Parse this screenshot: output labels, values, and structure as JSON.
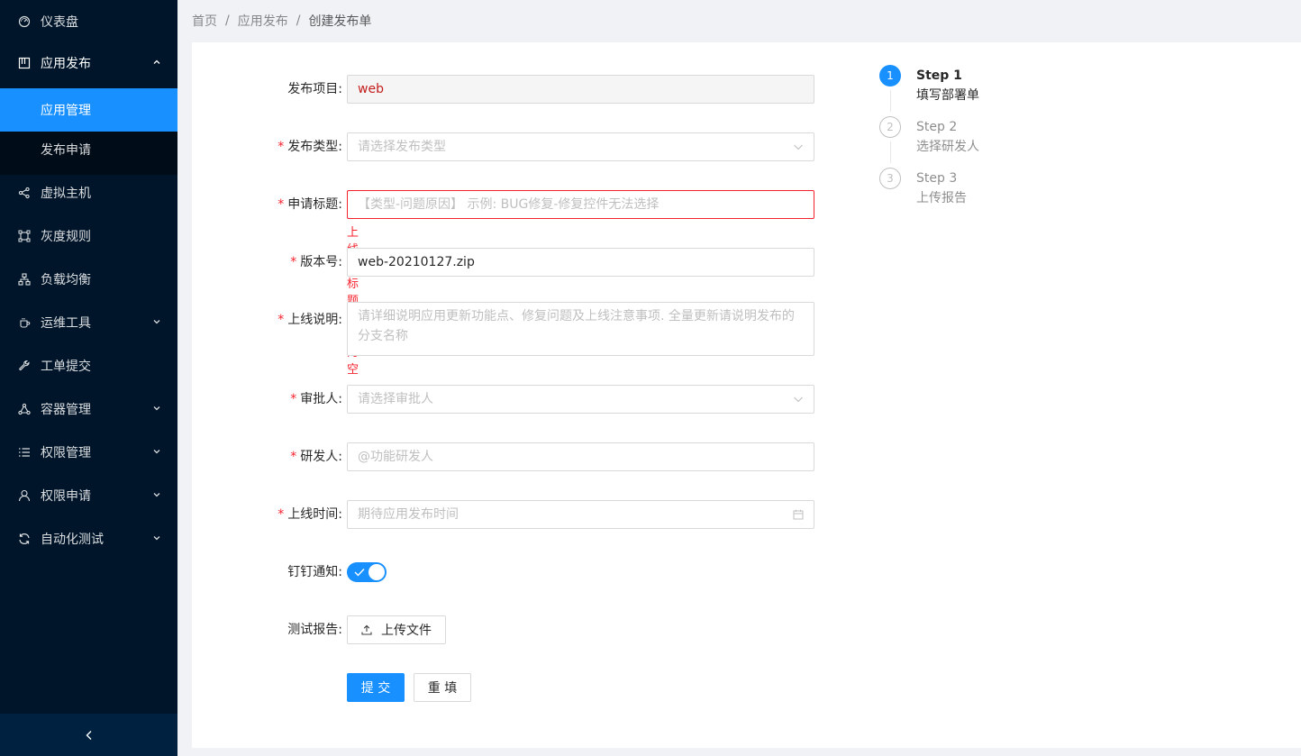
{
  "sidebar": {
    "items": [
      {
        "label": "仪表盘",
        "icon": "dashboard-icon"
      },
      {
        "label": "应用发布",
        "icon": "layout-icon",
        "expanded": true
      },
      {
        "label": "应用管理",
        "active": true
      },
      {
        "label": "发布申请"
      },
      {
        "label": "虚拟主机",
        "icon": "share-icon"
      },
      {
        "label": "灰度规则",
        "icon": "gateway-icon"
      },
      {
        "label": "负载均衡",
        "icon": "cluster-icon"
      },
      {
        "label": "运维工具",
        "icon": "tool-icon",
        "has_children": true
      },
      {
        "label": "工单提交",
        "icon": "wrench-icon"
      },
      {
        "label": "容器管理",
        "icon": "deployment-icon",
        "has_children": true
      },
      {
        "label": "权限管理",
        "icon": "list-icon",
        "has_children": true
      },
      {
        "label": "权限申请",
        "icon": "user-icon",
        "has_children": true
      },
      {
        "label": "自动化测试",
        "icon": "sync-icon",
        "has_children": true
      }
    ],
    "collapse_icon": "chevron-left-icon"
  },
  "breadcrumb": {
    "items": [
      "首页",
      "应用发布",
      "创建发布单"
    ],
    "separator": "/"
  },
  "form": {
    "project": {
      "label": "发布项目",
      "value": "web"
    },
    "release_type": {
      "label": "发布类型",
      "placeholder": "请选择发布类型",
      "required": true
    },
    "title": {
      "label": "申请标题",
      "placeholder": "【类型-问题原因】 示例: BUG修复-修复控件无法选择",
      "required": true,
      "error": "上线单标题不能为空"
    },
    "version": {
      "label": "版本号",
      "value": "web-20210127.zip",
      "required": true
    },
    "description": {
      "label": "上线说明",
      "placeholder": "请详细说明应用更新功能点、修复问题及上线注意事项. 全量更新请说明发布的分支名称",
      "required": true
    },
    "approver": {
      "label": "审批人",
      "placeholder": "请选择审批人",
      "required": true
    },
    "developer": {
      "label": "研发人",
      "placeholder": "@功能研发人",
      "required": true
    },
    "release_time": {
      "label": "上线时间",
      "placeholder": "期待应用发布时间",
      "required": true
    },
    "dingtalk": {
      "label": "钉钉通知",
      "checked": true
    },
    "test_report": {
      "label": "测试报告",
      "button": "上传文件"
    },
    "submit": "提 交",
    "reset": "重 填",
    "colon": ":",
    "required_mark": "*"
  },
  "steps": [
    {
      "number": "1",
      "title": "Step 1",
      "description": "填写部署单",
      "status": "process"
    },
    {
      "number": "2",
      "title": "Step 2",
      "description": "选择研发人",
      "status": "wait"
    },
    {
      "number": "3",
      "title": "Step 3",
      "description": "上传报告",
      "status": "wait"
    }
  ],
  "colors": {
    "sidebar_bg": "#001529",
    "primary": "#1890ff",
    "error": "#f5222d"
  }
}
